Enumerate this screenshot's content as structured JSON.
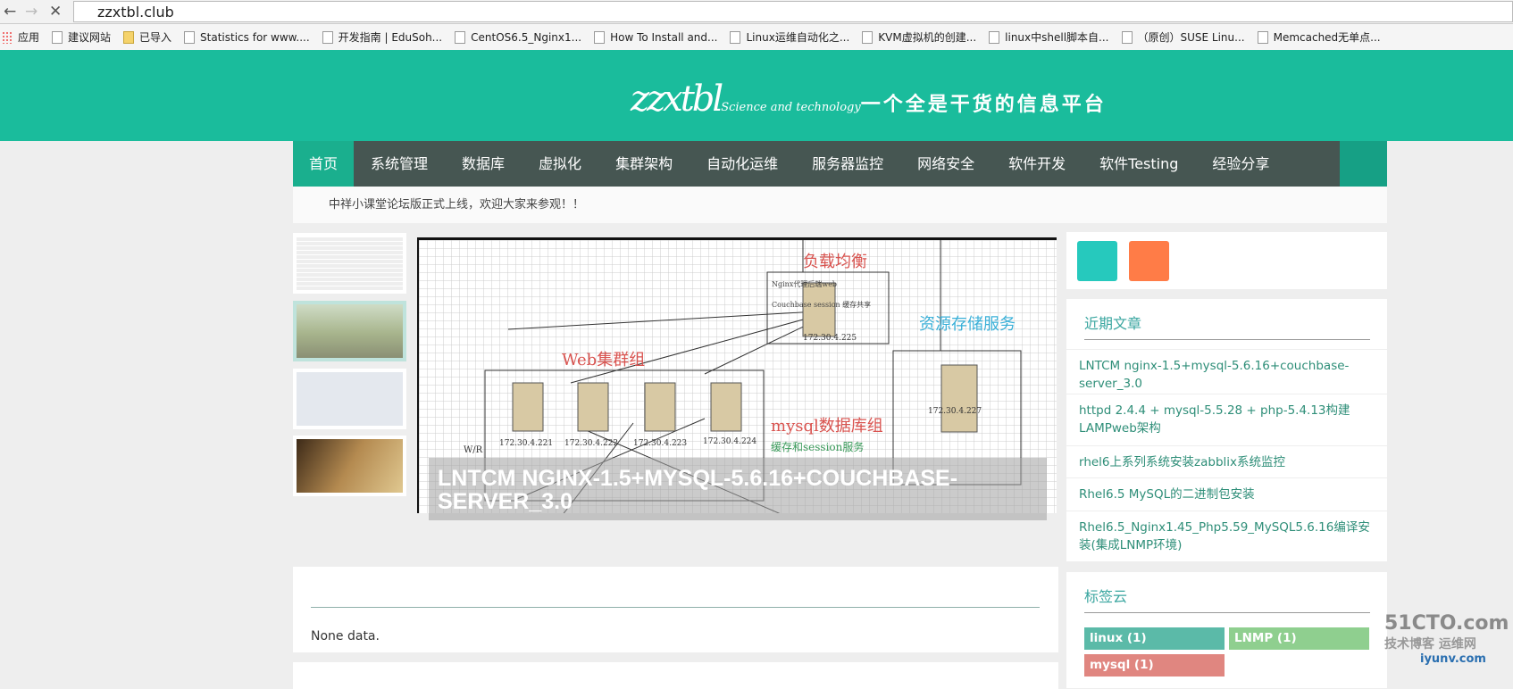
{
  "browser": {
    "url": "zzxtbl.club",
    "bookmarks": [
      "应用",
      "建议网站",
      "已导入",
      "Statistics for www....",
      "开发指南 | EduSoh...",
      "CentOS6.5_Nginx1...",
      "How To Install and...",
      "Linux运维自动化之...",
      "KVM虚拟机的创建...",
      "linux中shell脚本自...",
      "（原创）SUSE Linu...",
      "Memcached无单点..."
    ]
  },
  "header": {
    "logo_main": "zzxtbl",
    "logo_sub": "Science and technology",
    "slogan": "一个全是干货的信息平台",
    "brand_color": "#1abc9c"
  },
  "nav": {
    "items": [
      "首页",
      "系统管理",
      "数据库",
      "虚拟化",
      "集群架构",
      "自动化运维",
      "服务器监控",
      "网络安全",
      "软件开发",
      "软件Testing",
      "经验分享"
    ],
    "active": "首页"
  },
  "notice": "中祥小课堂论坛版正式上线，欢迎大家来参观！！",
  "slider": {
    "caption": "LNTCM NGINX-1.5+MYSQL-5.6.16+COUCHBASE-SERVER_3.0",
    "diagram": {
      "lb": "负载均衡",
      "lb_desc": "Nginx代理后端web",
      "cache": "Couchbase session 缓存共享",
      "lb_ip": "172.30.4.225",
      "web": "Web集群组",
      "web_ips": [
        "172.30.4.221",
        "172.30.4.222",
        "172.30.4.223",
        "172.30.4.224"
      ],
      "storage": "资源存储服务",
      "storage_ip": "172.30.4.227",
      "db": "mysql数据库组",
      "session": "缓存和session服务",
      "rw": "W/R"
    }
  },
  "content": {
    "empty": "None data."
  },
  "sidebar": {
    "squares": [
      "#26c9bd",
      "#ff7c47"
    ],
    "recent_title": "近期文章",
    "recent": [
      "LNTCM nginx-1.5+mysql-5.6.16+couchbase-server_3.0",
      "httpd 2.4.4 + mysql-5.5.28 + php-5.4.13构建LAMPweb架构",
      "rhel6上系列系统安装zabblix系统监控",
      "Rhel6.5 MySQL的二进制包安装",
      "Rhel6.5_Nginx1.45_Php5.59_MySQL5.6.16编译安装(集成LNMP环境)"
    ],
    "tags_title": "标签云",
    "tags": [
      {
        "label": "linux (1)",
        "color": "#5bbaa8"
      },
      {
        "label": "LNMP (1)",
        "color": "#8fcf8f"
      },
      {
        "label": "mysql (1)",
        "color": "#e08680"
      }
    ]
  },
  "watermark": {
    "line1": "51CTO.com",
    "line2": "技术博客",
    "line3": "运维网",
    "line4": "iyunv.com"
  }
}
